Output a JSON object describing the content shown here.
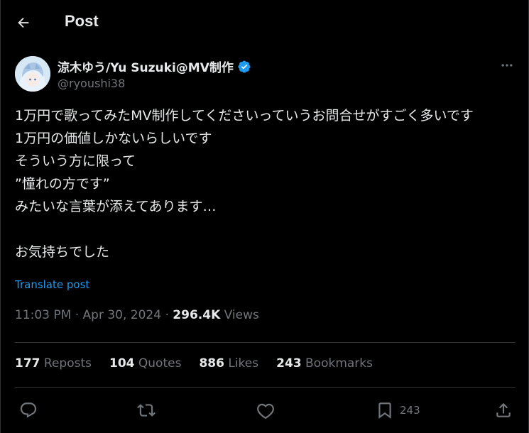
{
  "header": {
    "title": "Post",
    "back_icon": "arrow-left-icon"
  },
  "author": {
    "display_name": "涼木ゆう/Yu Suzuki@MV制作",
    "handle": "@ryoushi38",
    "verified_color": "#1d9bf0"
  },
  "post": {
    "text": "1万円で歌ってみたMV制作してくださいっていうお問合せがすごく多いです\n1万円の価値しかないらしいです\nそういう方に限って\n”憧れの方です”\nみたいな言葉が添えてあります…\n\nお気持ちでした",
    "translate_label": "Translate post",
    "time": "11:03 PM",
    "date": "Apr 30, 2024",
    "separator": "·",
    "views_count": "296.4K",
    "views_label": "Views"
  },
  "stats": [
    {
      "count": "177",
      "label": "Reposts"
    },
    {
      "count": "104",
      "label": "Quotes"
    },
    {
      "count": "886",
      "label": "Likes"
    },
    {
      "count": "243",
      "label": "Bookmarks"
    }
  ],
  "actions": {
    "bookmark_count": "243"
  },
  "colors": {
    "background": "#000000",
    "text": "#e7e9ea",
    "muted": "#71767b",
    "accent": "#1d9bf0",
    "divider": "#2f3336"
  }
}
